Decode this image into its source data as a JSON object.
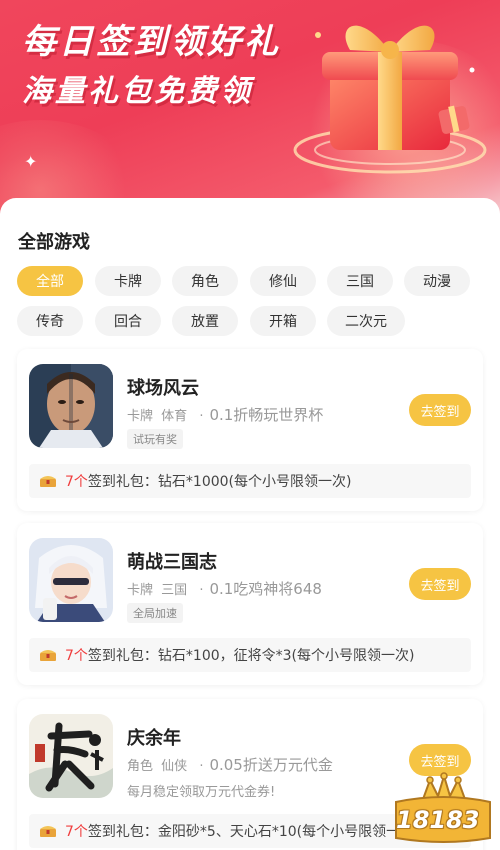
{
  "banner": {
    "headline": "每日签到领好礼",
    "subline": "海量礼包免费领"
  },
  "section": {
    "title": "全部游戏"
  },
  "categories": [
    {
      "label": "全部",
      "active": true
    },
    {
      "label": "卡牌"
    },
    {
      "label": "角色"
    },
    {
      "label": "修仙"
    },
    {
      "label": "三国"
    },
    {
      "label": "动漫"
    },
    {
      "label": "传奇"
    },
    {
      "label": "回合"
    },
    {
      "label": "放置"
    },
    {
      "label": "开箱"
    },
    {
      "label": "二次元"
    }
  ],
  "games": [
    {
      "name": "球场风云",
      "genre1": "卡牌",
      "genre2": "体育",
      "slogan": "0.1折畅玩世界杯",
      "tag": "试玩有奖",
      "button": "去签到",
      "gift_count": "7个",
      "gift_prefix": "签到礼包：",
      "gift_detail": "钻石*1000(每个小号限领一次)"
    },
    {
      "name": "萌战三国志",
      "genre1": "卡牌",
      "genre2": "三国",
      "slogan": "0.1吃鸡神将648",
      "tag": "全局加速",
      "button": "去签到",
      "gift_count": "7个",
      "gift_prefix": "签到礼包：",
      "gift_detail": "钻石*100，征将令*3(每个小号限领一次)"
    },
    {
      "name": "庆余年",
      "genre1": "角色",
      "genre2": "仙侠",
      "slogan": "0.05折送万元代金",
      "note": "每月稳定领取万元代金券!",
      "button": "去签到",
      "gift_count": "7个",
      "gift_prefix": "签到礼包：",
      "gift_detail": "金阳砂*5、天心石*10(每个小号限领一次)"
    }
  ],
  "watermark": {
    "text": "18183"
  },
  "colors": {
    "accent": "#f6c443",
    "banner": "#ee3e57",
    "gift_count": "#f03e3e"
  }
}
